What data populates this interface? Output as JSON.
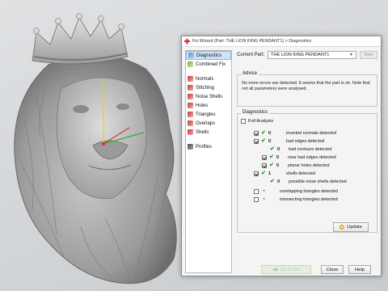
{
  "dialog": {
    "title": "Fix Wizard (Part: THE LION KING PENDANT1) > Diagnostics",
    "current_part_label": "Current Part:",
    "current_part_value": "THE LION KING PENDANT1",
    "new_label": "New"
  },
  "sidebar": {
    "items": [
      {
        "label": "Diagnostics",
        "icon": "diagnostics-icon",
        "selected": true
      },
      {
        "label": "Combined Fix",
        "icon": "combined-fix-icon"
      },
      {
        "label": "Normals",
        "icon": "normals-icon"
      },
      {
        "label": "Stitching",
        "icon": "stitching-icon"
      },
      {
        "label": "Noise Shells",
        "icon": "noise-shells-icon"
      },
      {
        "label": "Holes",
        "icon": "holes-icon"
      },
      {
        "label": "Triangles",
        "icon": "triangles-icon"
      },
      {
        "label": "Overlaps",
        "icon": "overlaps-icon"
      },
      {
        "label": "Shells",
        "icon": "shells-icon"
      },
      {
        "label": "Profiles",
        "icon": "profiles-icon"
      }
    ]
  },
  "advice": {
    "label": "Advice",
    "text": "No more errors are detected. It seems that the part is ok. Note that not all parameters were analysed."
  },
  "diagnostics": {
    "label": "Diagnostics",
    "full_analysis_label": "Full Analysis",
    "rows": [
      {
        "checked": true,
        "status": "ok",
        "count": "0",
        "label": "inverted normals detected"
      },
      {
        "checked": true,
        "status": "ok",
        "count": "0",
        "label": "bad edges detected"
      },
      {
        "checked": false,
        "status": "ok",
        "count": "0",
        "label": "bad contours detected"
      },
      {
        "checked": true,
        "status": "ok",
        "count": "0",
        "label": "near bad edges detected"
      },
      {
        "checked": true,
        "status": "ok",
        "count": "0",
        "label": "planar holes detected"
      },
      {
        "checked": true,
        "status": "ok",
        "count": "1",
        "label": "shells detected"
      },
      {
        "checked": false,
        "status": "ok",
        "count": "0",
        "label": "possible noise shells detected"
      },
      {
        "checked": false,
        "status": "unknown",
        "count": "",
        "label": "overlapping triangles detected"
      },
      {
        "checked": false,
        "status": "unknown",
        "count": "",
        "label": "intersecting triangles detected"
      }
    ],
    "update_label": "Update"
  },
  "buttons": {
    "fix_label": "Go to Fix",
    "close_label": "Close",
    "help_label": "Help"
  },
  "colors": {
    "ok_tick": "#2a9a2a",
    "unknown_dot": "#3a4ab0",
    "selected_bg": "#cfe3f7",
    "axis_x": "#e03030",
    "axis_y": "#e6d21a",
    "axis_z": "#30b030"
  }
}
